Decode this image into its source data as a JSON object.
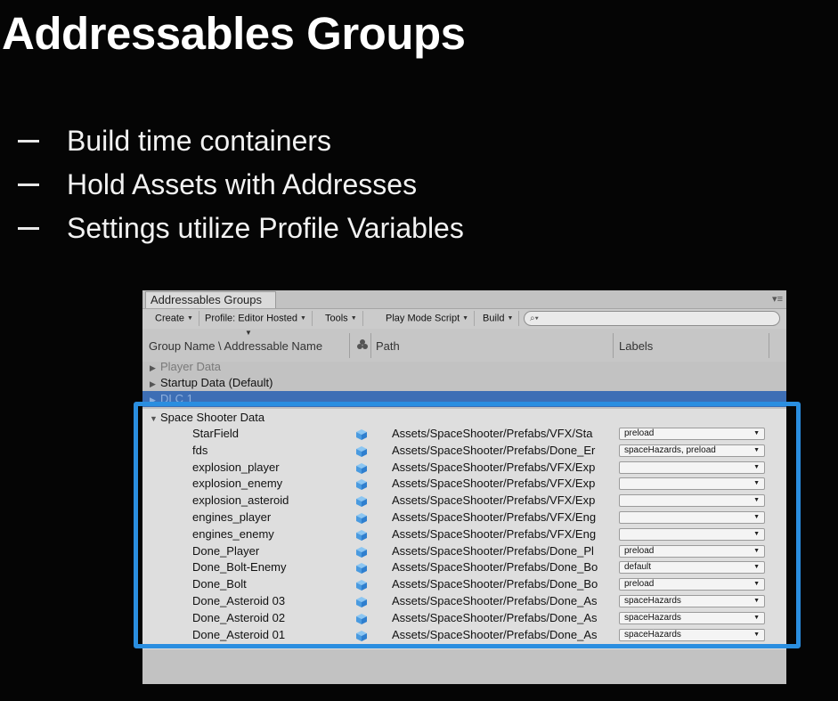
{
  "slide": {
    "title": "Addressables Groups",
    "bullets": [
      "Build time containers",
      "Hold Assets with Addresses",
      "Settings utilize Profile Variables"
    ]
  },
  "window": {
    "tab_title": "Addressables Groups",
    "menu_glyph": "▾≡",
    "toolbar": {
      "create": "Create",
      "profile": "Profile: Editor Hosted",
      "tools": "Tools",
      "play_mode": "Play Mode Script",
      "build": "Build",
      "search_value": ""
    },
    "columns": {
      "name": "Group Name \\ Addressable Name",
      "path": "Path",
      "labels": "Labels"
    },
    "groups": [
      "Player Data",
      "Startup Data (Default)",
      "DLC 1"
    ],
    "active_group": "Space Shooter Data",
    "entries": [
      {
        "name": "StarField",
        "path": "Assets/SpaceShooter/Prefabs/VFX/Sta",
        "labels": "preload"
      },
      {
        "name": "fds",
        "path": "Assets/SpaceShooter/Prefabs/Done_Er",
        "labels": "spaceHazards, preload"
      },
      {
        "name": "explosion_player",
        "path": "Assets/SpaceShooter/Prefabs/VFX/Exp",
        "labels": ""
      },
      {
        "name": "explosion_enemy",
        "path": "Assets/SpaceShooter/Prefabs/VFX/Exp",
        "labels": ""
      },
      {
        "name": "explosion_asteroid",
        "path": "Assets/SpaceShooter/Prefabs/VFX/Exp",
        "labels": ""
      },
      {
        "name": "engines_player",
        "path": "Assets/SpaceShooter/Prefabs/VFX/Eng",
        "labels": ""
      },
      {
        "name": "engines_enemy",
        "path": "Assets/SpaceShooter/Prefabs/VFX/Eng",
        "labels": ""
      },
      {
        "name": "Done_Player",
        "path": "Assets/SpaceShooter/Prefabs/Done_Pl",
        "labels": "preload"
      },
      {
        "name": "Done_Bolt-Enemy",
        "path": "Assets/SpaceShooter/Prefabs/Done_Bo",
        "labels": "default"
      },
      {
        "name": "Done_Bolt",
        "path": "Assets/SpaceShooter/Prefabs/Done_Bo",
        "labels": "preload"
      },
      {
        "name": "Done_Asteroid 03",
        "path": "Assets/SpaceShooter/Prefabs/Done_As",
        "labels": "spaceHazards"
      },
      {
        "name": "Done_Asteroid 02",
        "path": "Assets/SpaceShooter/Prefabs/Done_As",
        "labels": "spaceHazards"
      },
      {
        "name": "Done_Asteroid 01",
        "path": "Assets/SpaceShooter/Prefabs/Done_As",
        "labels": "spaceHazards"
      }
    ]
  },
  "colors": {
    "highlight": "#2a8ee0",
    "selected_row": "#3d6eb5",
    "asset_icon": "#4a9be0"
  }
}
